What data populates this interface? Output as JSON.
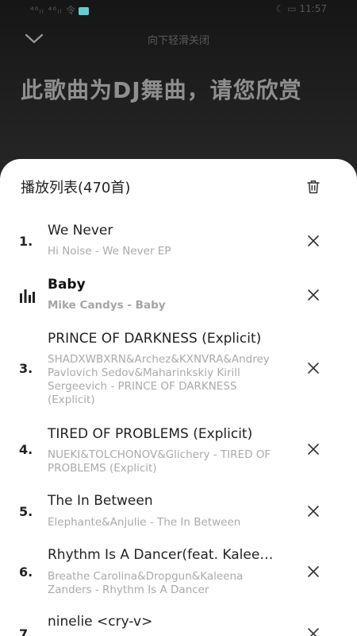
{
  "status_bar": {
    "left": "⁴⁶ᵢₗ ⁴⁶ᵢₗ 令",
    "right": "☾ ▭ 11:57"
  },
  "header": {
    "swipe_hint": "向下轻滑关闭",
    "dj_notice": "此歌曲为DJ舞曲，请您欣赏"
  },
  "playlist": {
    "title": "播放列表(470首)",
    "songs": [
      {
        "index": "1.",
        "title": "We Never",
        "subtitle": "Hi Noise - We Never EP"
      },
      {
        "index": "",
        "title": "Baby",
        "subtitle": "Mike Candys - Baby",
        "playing": true
      },
      {
        "index": "3.",
        "title": "PRINCE OF DARKNESS (Explicit)",
        "subtitle": "SHADXWBXRN&Archez&KXNVRA&Andrey Pavlovich Sedov&Maharinkskiy Kirill Sergeevich - PRINCE OF DARKNESS (Explicit)"
      },
      {
        "index": "4.",
        "title": "TIRED OF PROBLEMS (Explicit)",
        "subtitle": "NUEKI&TOLCHONOV&Glichery - TIRED OF PROBLEMS (Explicit)"
      },
      {
        "index": "5.",
        "title": "The In Between",
        "subtitle": "Elephante&Anjulie - The In Between"
      },
      {
        "index": "6.",
        "title": "Rhythm Is A Dancer(feat. Kaleena Zanders)",
        "subtitle": "Breathe Carolina&Dropgun&Kaleena Zanders - Rhythm Is A Dancer"
      },
      {
        "index": "7.",
        "title": "ninelie <cry-v>",
        "subtitle": ""
      }
    ]
  },
  "icons": {
    "collapse": "chevron-down-icon",
    "clear": "trash-icon",
    "remove": "close-icon",
    "now_playing": "equalizer-icon"
  },
  "colors": {
    "sheet": "#ffffff",
    "backdrop": "#262626",
    "primary_text": "#222222",
    "secondary_text": "#aaaaaa"
  }
}
